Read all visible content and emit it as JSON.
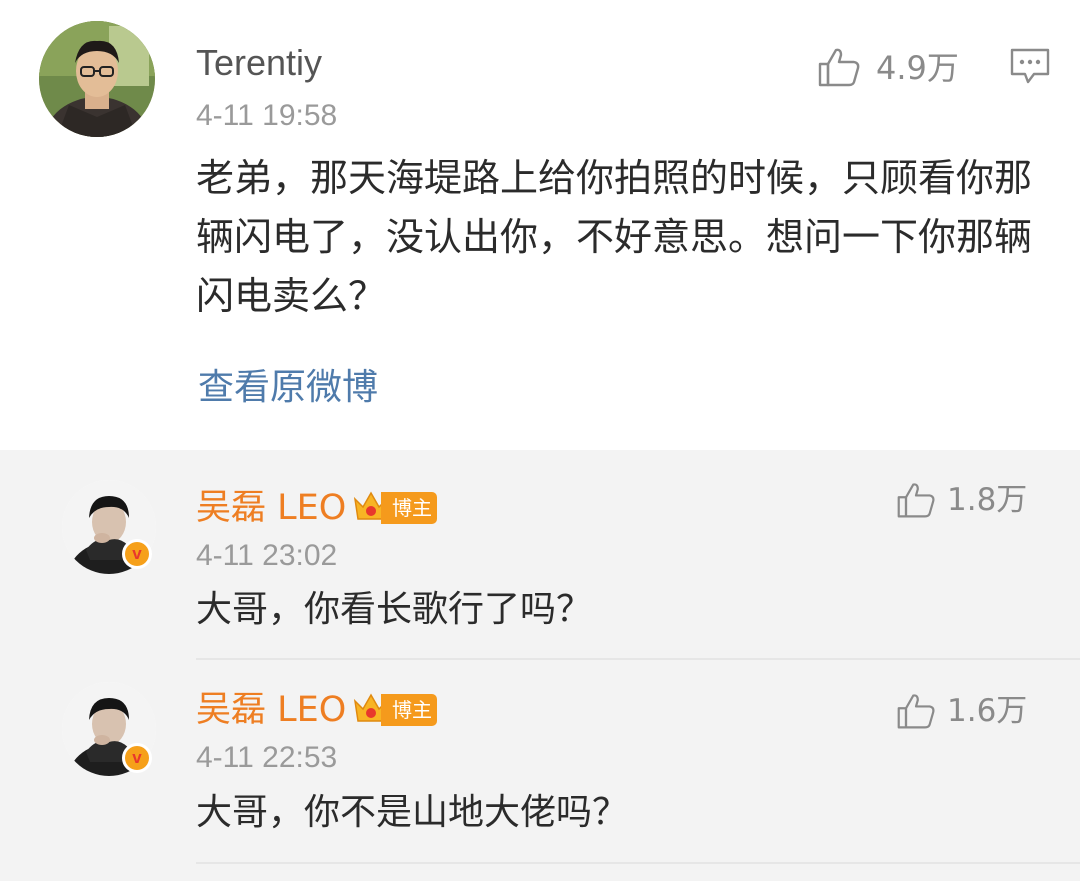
{
  "main_comment": {
    "username": "Terentiy",
    "timestamp": "4-11 19:58",
    "likes": "4.9万",
    "text": "老弟，那天海堤路上给你拍照的时候，只顾看你那辆闪电了，没认出你，不好意思。想问一下你那辆闪电卖么？",
    "view_original_label": "查看原微博"
  },
  "replies": [
    {
      "username": "吴磊 LEO",
      "badge_label": "博主",
      "verified_mark": "v",
      "timestamp": "4-11 23:02",
      "likes": "1.8万",
      "text": "大哥，你看长歌行了吗？"
    },
    {
      "username": "吴磊 LEO",
      "badge_label": "博主",
      "verified_mark": "v",
      "timestamp": "4-11 22:53",
      "likes": "1.6万",
      "text": "大哥，你不是山地大佬吗？"
    }
  ],
  "icons": {
    "like": "thumbs-up-icon",
    "reply": "comment-bubble-icon",
    "verified": "verified-v-icon",
    "crown": "crown-icon"
  },
  "colors": {
    "username_main": "#555555",
    "username_blogger": "#ee7e22",
    "link": "#4f7bab",
    "badge": "#f59a1c",
    "panel_bg": "#f3f3f3"
  }
}
